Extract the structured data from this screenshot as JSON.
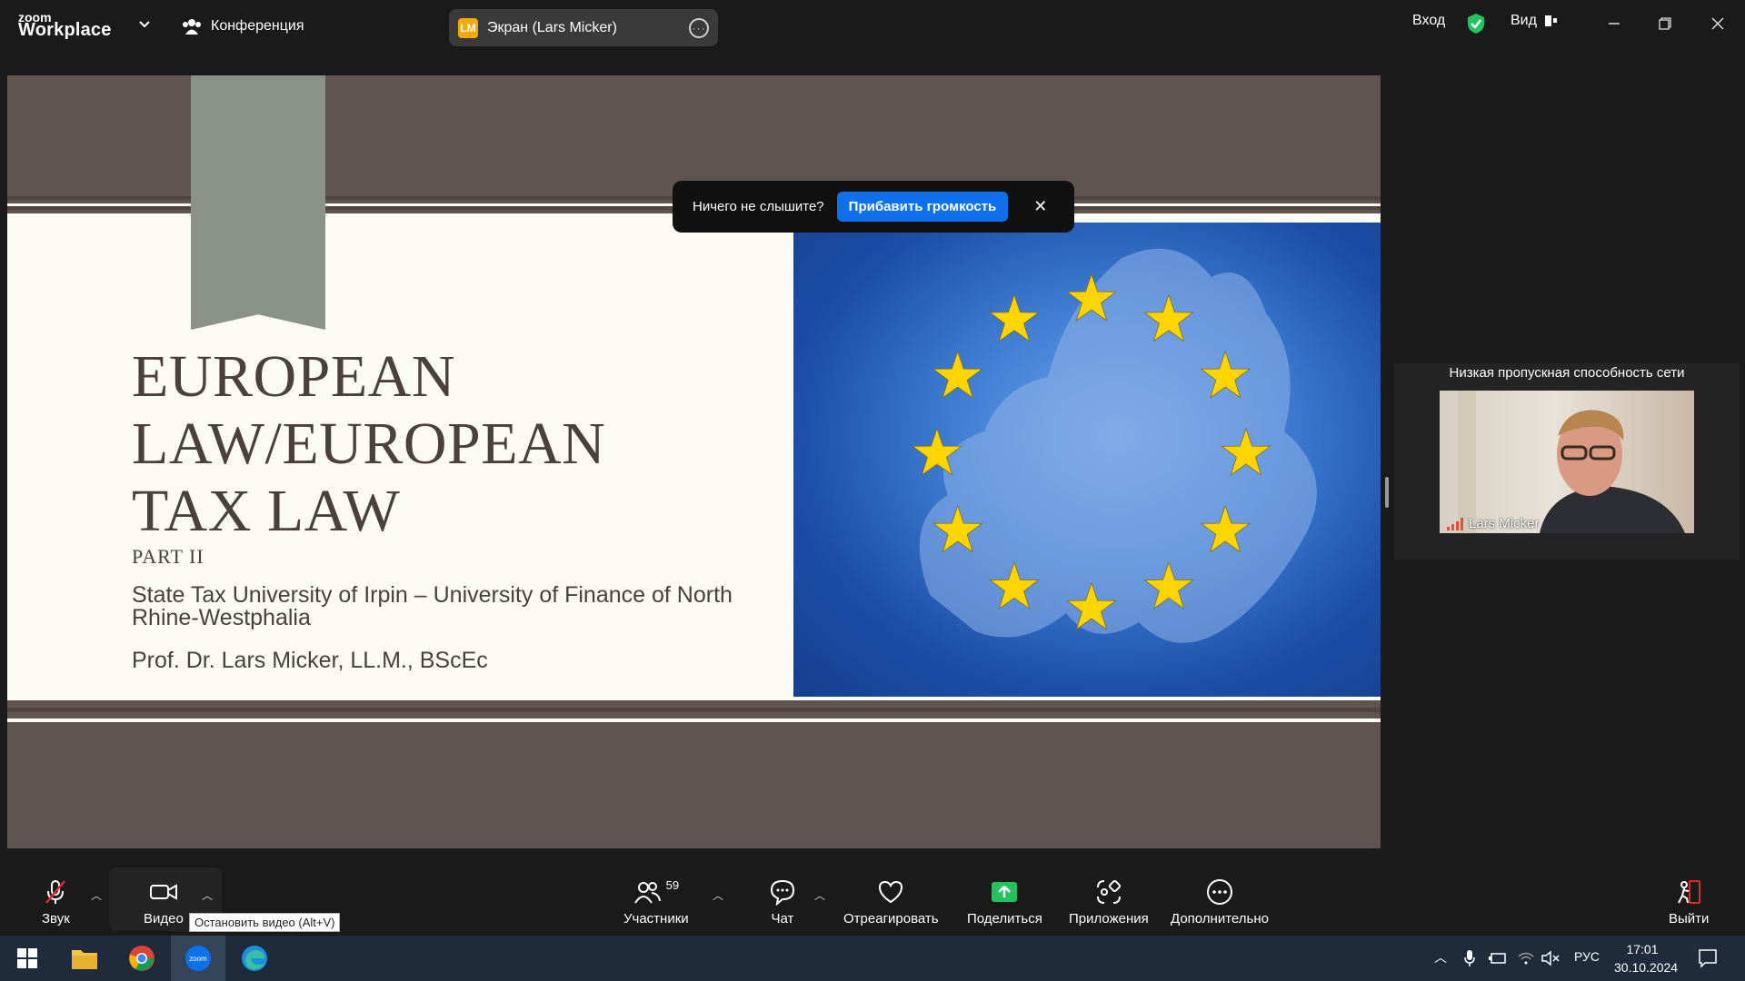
{
  "app": {
    "brand_small": "zoom",
    "brand_name": "Workplace",
    "meeting_label": "Конференция",
    "share_badge": "LM",
    "share_title": "Экран (Lars Micker)",
    "signin_label": "Вход",
    "view_label": "Вид"
  },
  "slide": {
    "title": "EUROPEAN\nLAW/EUROPEAN\nTAX LAW",
    "part": "PART II",
    "university": "State Tax University of Irpin –  University of Finance of North Rhine-Westphalia",
    "professor": "Prof.  Dr.  Lars Micker, LL.M., BScEc"
  },
  "toast": {
    "text": "Ничего не слышите?",
    "button": "Прибавить громкость"
  },
  "participant": {
    "network_warning": "Низкая пропускная способность сети",
    "name": "Lars Micker"
  },
  "toolbar": {
    "audio": "Звук",
    "video": "Видео",
    "video_tooltip": "Остановить видео (Alt+V)",
    "participants": "Участники",
    "participants_count": "59",
    "chat": "Чат",
    "react": "Отреагировать",
    "share": "Поделиться",
    "apps": "Приложения",
    "more": "Дополнительно",
    "leave": "Выйти"
  },
  "taskbar": {
    "language": "РУС",
    "time": "17:01",
    "date": "30.10.2024"
  },
  "colors": {
    "accent_blue": "#0e71eb",
    "share_green": "#21c35c",
    "leave_red": "#e02828",
    "slide_brown": "#5e5450",
    "eu_star_yellow": "#ffd500"
  }
}
